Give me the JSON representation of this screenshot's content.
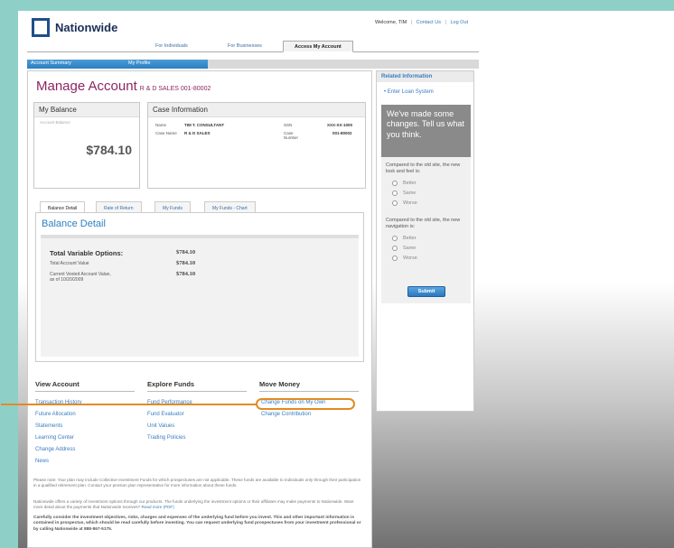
{
  "header": {
    "logo_text": "Nationwide",
    "welcome": "Welcome, TIM",
    "contact": "Contact Us",
    "logout": "Log Out",
    "sep": "|"
  },
  "top_tabs": [
    "For Individuals",
    "For Businesses",
    "Access My Account"
  ],
  "subnav": [
    "Account Summary",
    "My Profile"
  ],
  "page": {
    "title": "Manage Account",
    "subtitle": "R & D SALES 001-80002"
  },
  "my_balance": {
    "heading": "My Balance",
    "label": "Account Balance",
    "value": "$784.10"
  },
  "case_info": {
    "heading": "Case Information",
    "name_label": "Name",
    "name_value": "TIM T. CONSULTANT",
    "ssn_label": "SSN",
    "ssn_value": "XXX-XX-1000",
    "case_name_label": "Case Name",
    "case_name_value": "R & D SALES",
    "case_number_label": "Case\nNumber",
    "case_number_value": "001-80002"
  },
  "detail_tabs": [
    "Balance Detail",
    "Rate of Return",
    "My Funds",
    "My Funds - Chart"
  ],
  "balance_detail": {
    "title": "Balance Detail",
    "rows": [
      {
        "label": "Total Variable Options:",
        "value": "$784.10"
      },
      {
        "label": "Total Account Value",
        "value": "$784.10"
      },
      {
        "label": "Current Vested Account Value,\nas of 10/20/2009",
        "value": "$784.10"
      }
    ]
  },
  "columns": {
    "view_account": {
      "heading": "View Account",
      "links": [
        "Transaction History",
        "Future Allocation",
        "Statements",
        "Learning Center",
        "Change Address",
        "News"
      ]
    },
    "explore_funds": {
      "heading": "Explore Funds",
      "links": [
        "Fund Performance",
        "Fund Evaluator",
        "Unit Values",
        "Trading Policies"
      ]
    },
    "move_money": {
      "heading": "Move Money",
      "links": [
        "Change Funds on My Own",
        "Change Contribution"
      ]
    }
  },
  "fine_print": {
    "p1": "Please note: Your plan may include Collective Investment Funds for which prospectuses are not applicable. These funds are available to individuals only through their participation in a qualified retirement plan. Contact your pension plan representative for more information about these funds.",
    "p2": "Nationwide offers a variety of investment options through our products. The funds underlying the investment options or their affiliates may make payments to Nationwide. Want more detail about the payments that Nationwide receives?",
    "p2_link": "Read more (PDF)",
    "p3": "Carefully consider the investment objectives, risks, charges and expenses of the underlying fund before you invest. This and other important information is contained in prospectus, which should be read carefully before investing. You can request underlying fund prospectuses from your investment professional or by calling Nationwide at 888-867-5175."
  },
  "sidebar": {
    "heading": "Related Information",
    "link": "Enter Loan System",
    "survey_head": "We've made some changes. Tell us what you think.",
    "q1": "Compared to the old site, the new look and feel is:",
    "q2": "Compared to the old site, the new navigation is:",
    "options": [
      "Better",
      "Same",
      "Worse"
    ],
    "submit": "Submit"
  },
  "colors": {
    "brand_blue": "#1f4e8c",
    "title_magenta": "#8e2464",
    "link_blue": "#3a7cc0",
    "highlight_orange": "#e58a1f"
  }
}
